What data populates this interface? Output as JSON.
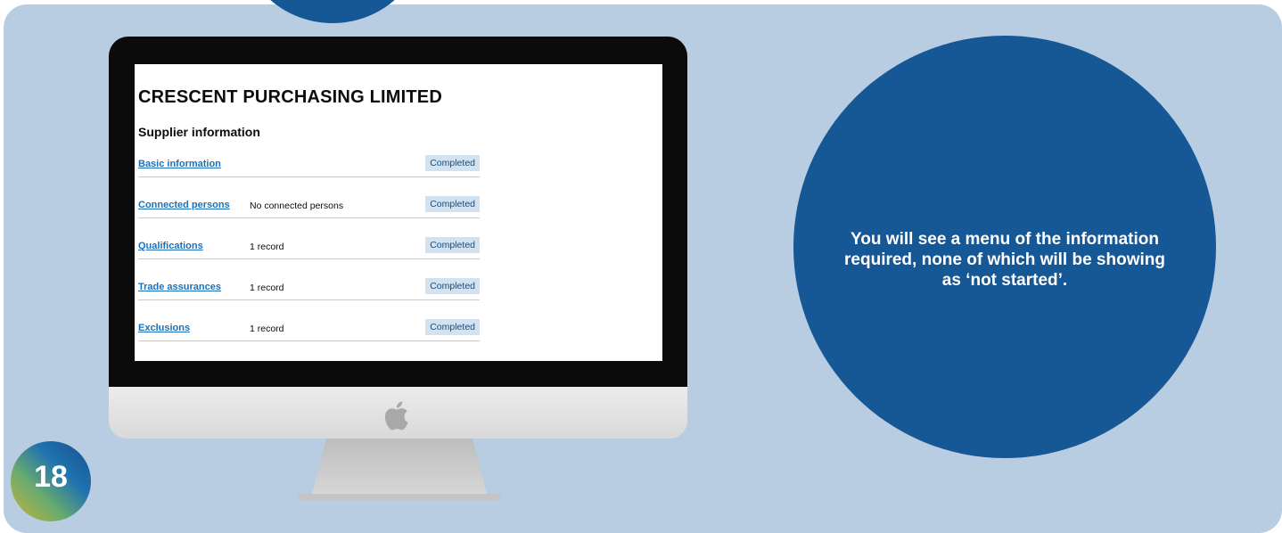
{
  "organisation": {
    "name": "CRESCENT PURCHASING LIMITED"
  },
  "supplier_section": {
    "title": "Supplier information",
    "rows": [
      {
        "label": "Basic information",
        "value": "",
        "status": "Completed"
      },
      {
        "label": "Connected persons",
        "value": "No connected persons",
        "status": "Completed"
      },
      {
        "label": "Qualifications",
        "value": "1 record",
        "status": "Completed"
      },
      {
        "label": "Trade assurances",
        "value": "1 record",
        "status": "Completed"
      },
      {
        "label": "Exclusions",
        "value": "1 record",
        "status": "Completed"
      }
    ]
  },
  "callout": {
    "text": "You will see a menu of the information required, none of which will be showing as ‘not started’."
  },
  "step": {
    "number": "18"
  },
  "colors": {
    "panel_background": "#b8cde2",
    "circle_blue": "#165796",
    "link_blue": "#1d70b8",
    "status_tag_background": "#d2e2f1",
    "status_tag_text": "#144e81"
  },
  "icons": {
    "device_logo": "apple-logo-icon"
  }
}
